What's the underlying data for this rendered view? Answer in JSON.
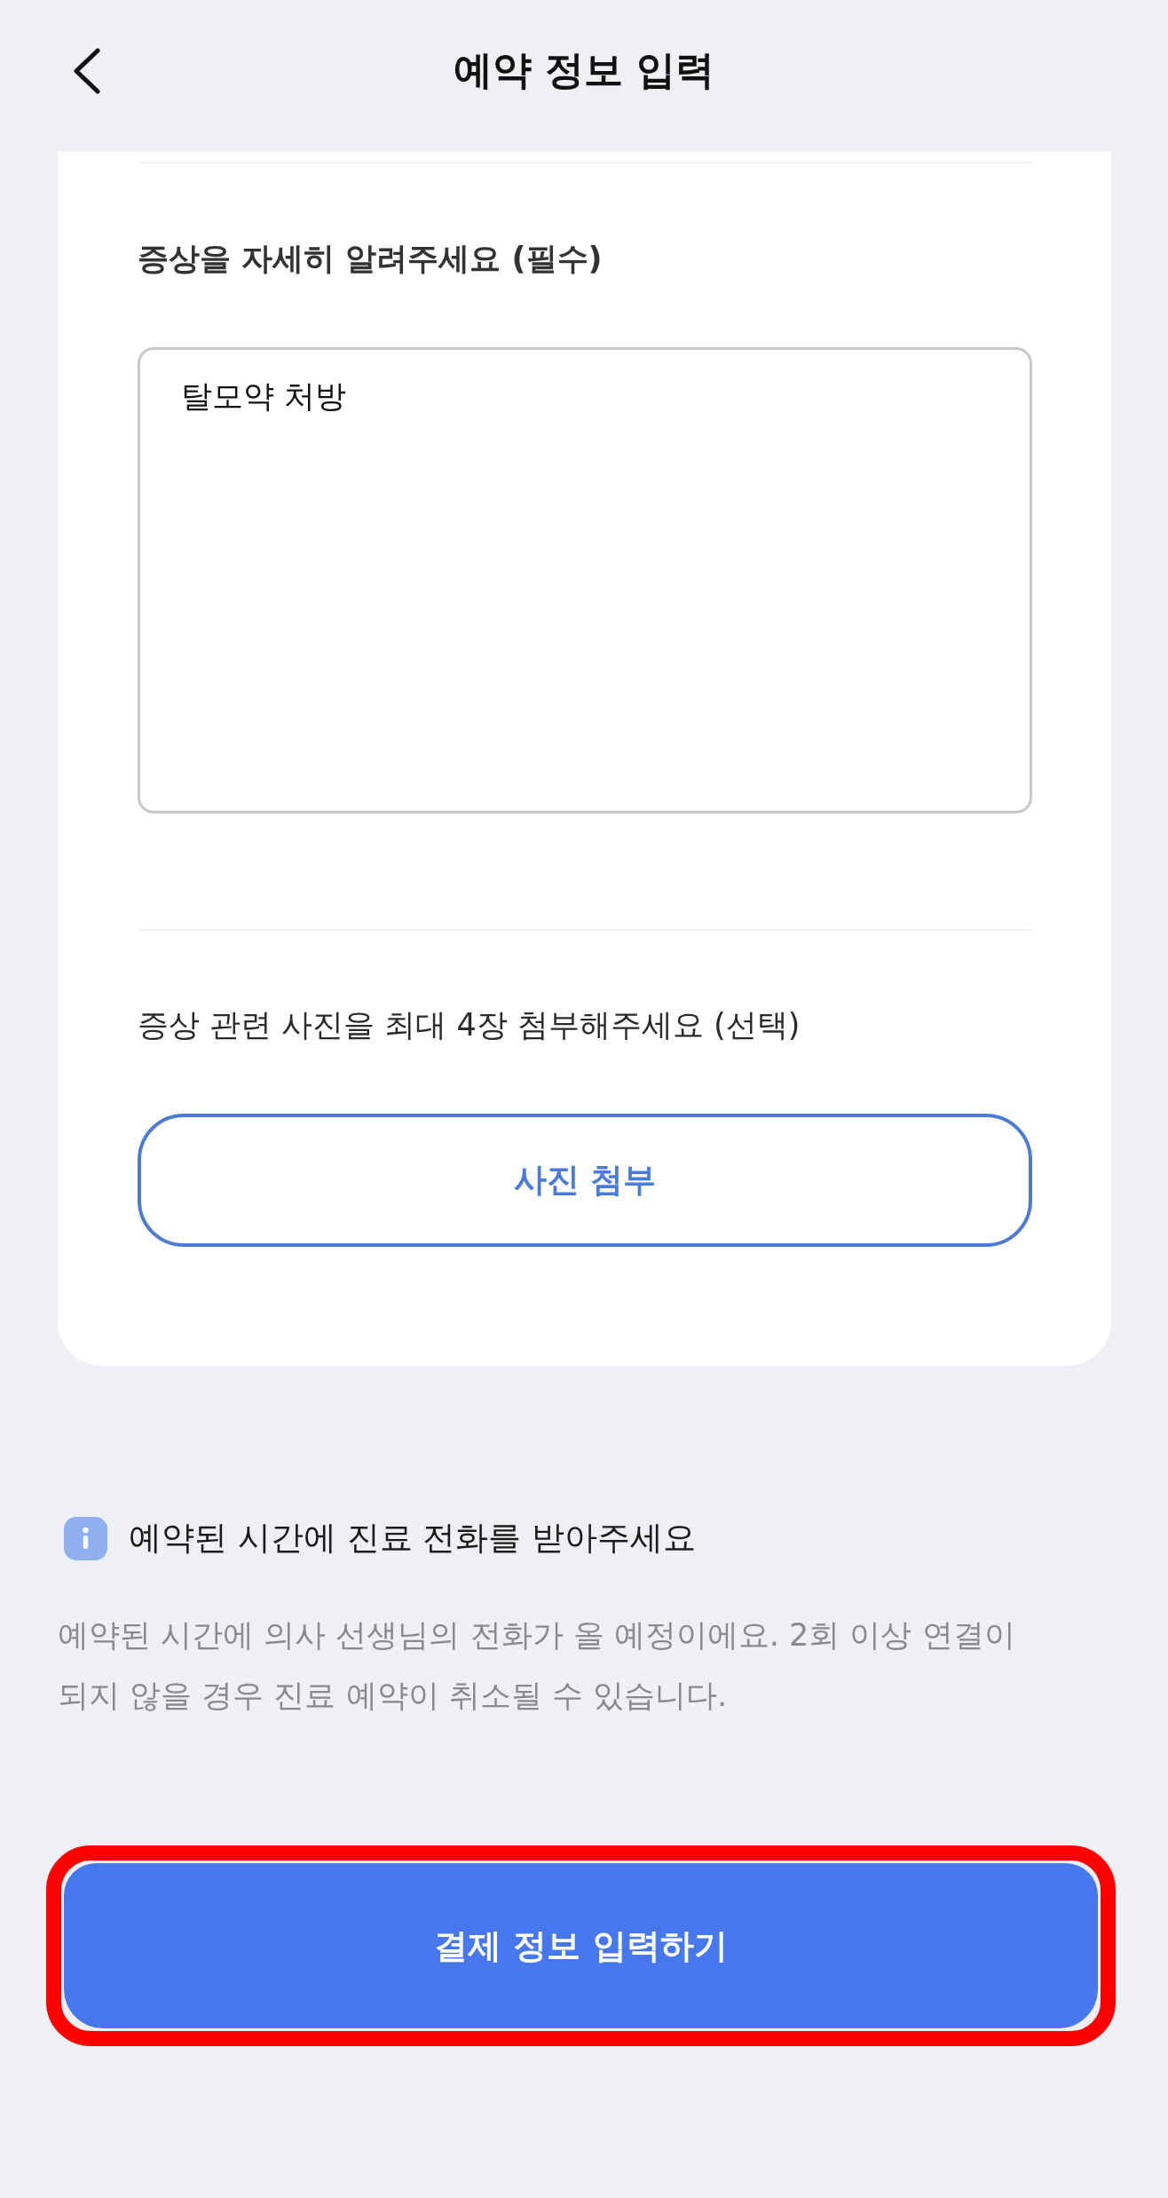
{
  "header": {
    "title": "예약 정보 입력"
  },
  "symptoms": {
    "label": "증상을 자세히 알려주세요 (필수)",
    "value": "탈모약 처방"
  },
  "photos": {
    "label": "증상 관련 사진을 최대 4장 첨부해주세요 (선택)",
    "button": "사진 첨부"
  },
  "notice": {
    "title": "예약된 시간에 진료 전화를 받아주세요",
    "body": "예약된 시간에 의사 선생님의 전화가 올 예정이에요. 2회 이상 연결이 되지 않을 경우 진료 예약이 취소될 수 있습니다."
  },
  "submit_button": {
    "label": "결제 정보 입력하기",
    "highlighted": true
  }
}
